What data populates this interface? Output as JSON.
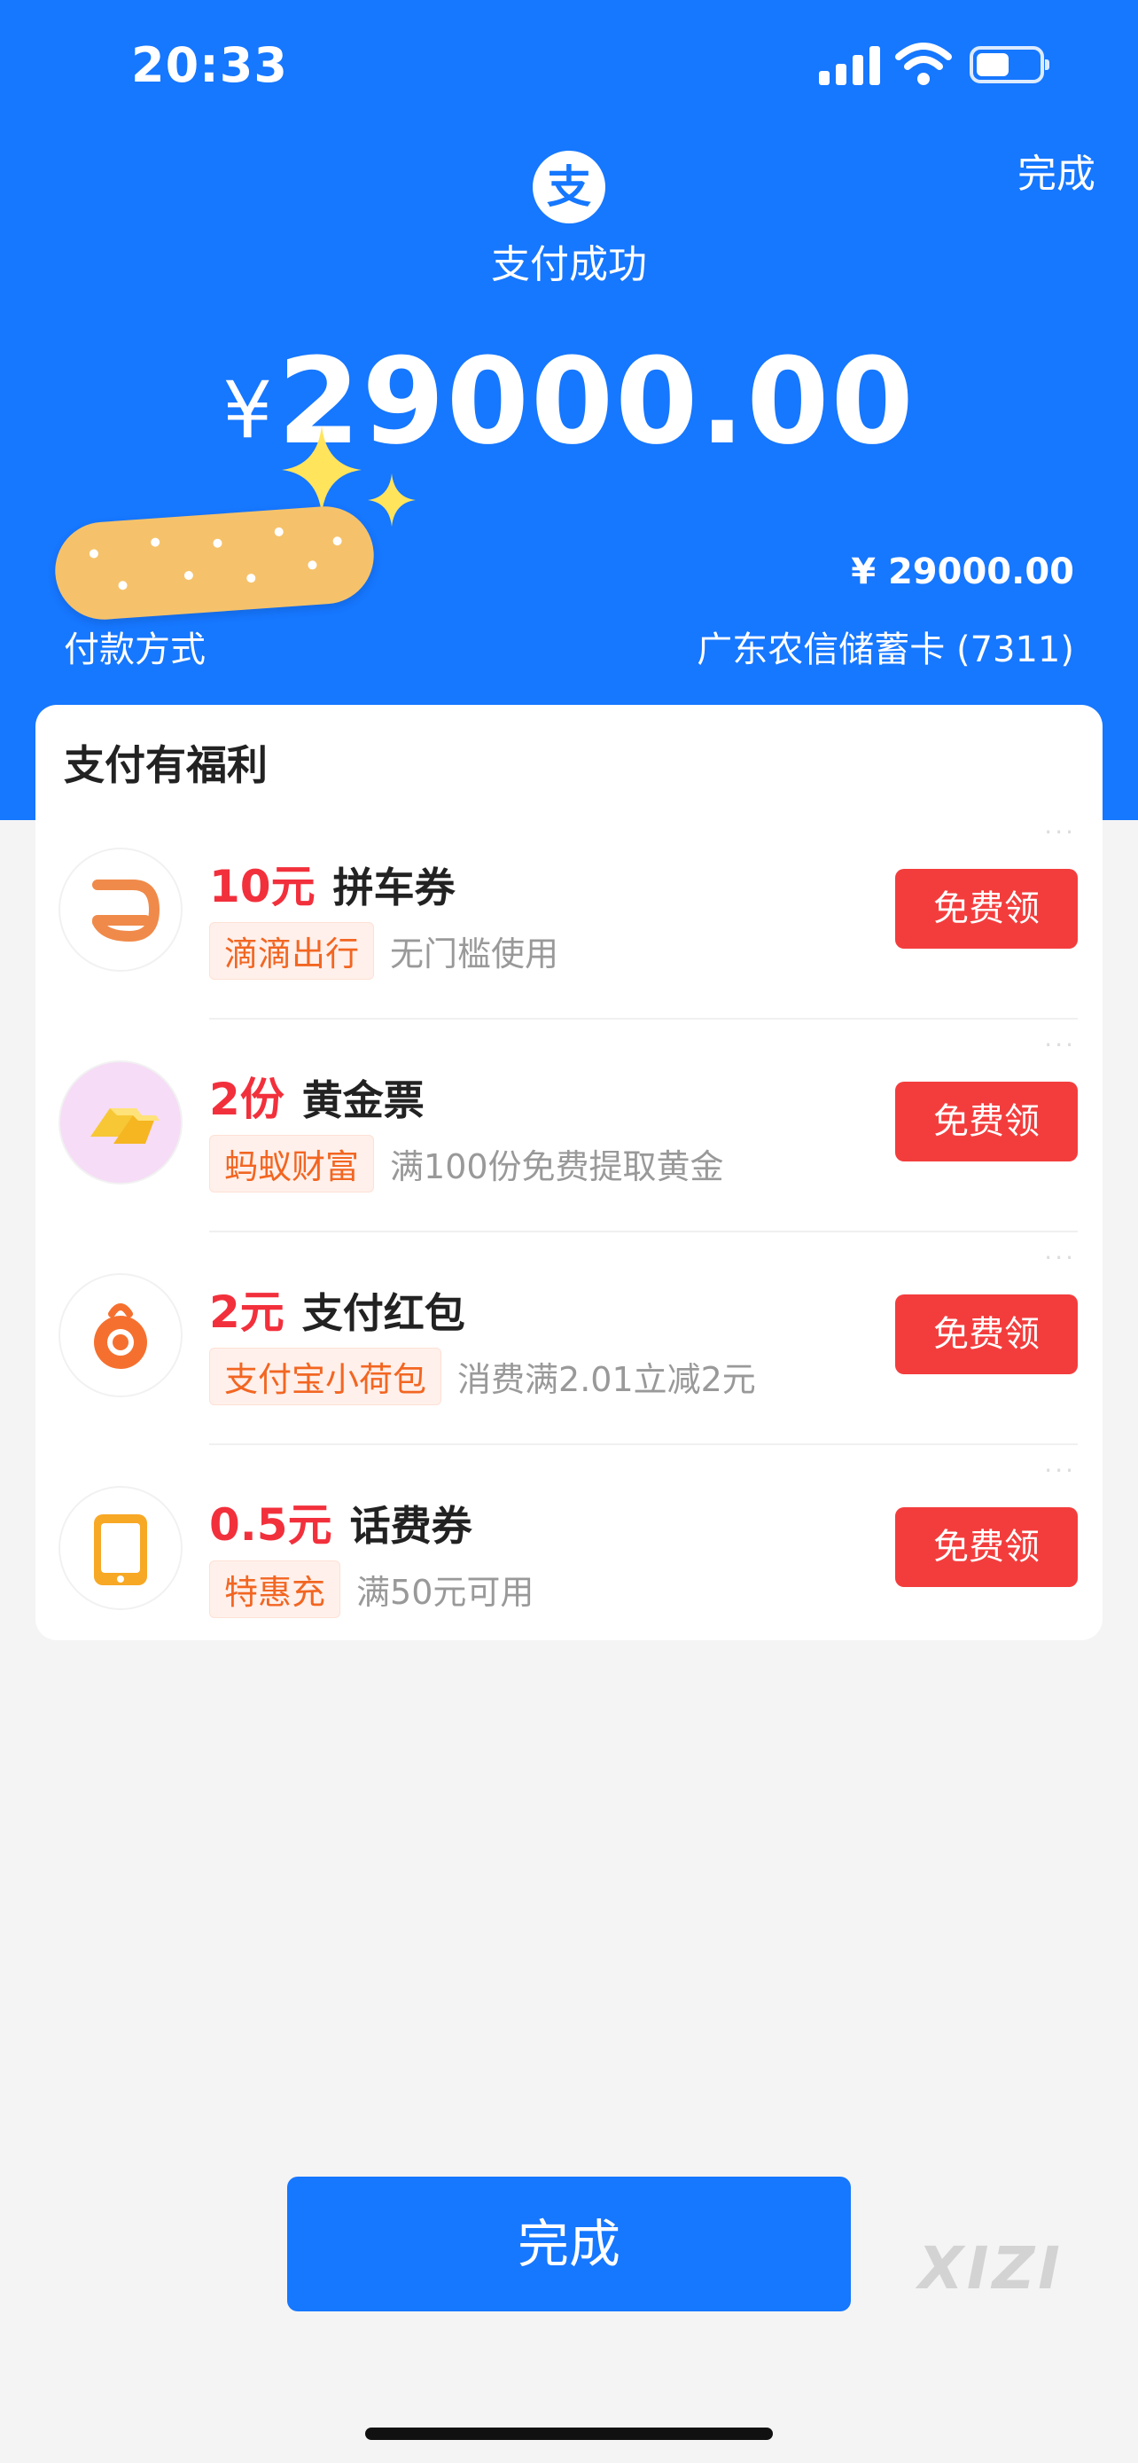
{
  "status_bar": {
    "time": "20:33"
  },
  "header": {
    "done_label": "完成",
    "logo_glyph": "支",
    "title": "支付成功",
    "currency_symbol": "¥",
    "amount": "29000.00",
    "paid_amount": "¥ 29000.00",
    "payment_method_label": "付款方式",
    "payment_method_value": "广东农信储蓄卡 (7311)"
  },
  "benefits": {
    "title": "支付有福利",
    "items": [
      {
        "amount": "10元",
        "name": "拼车券",
        "tag": "滴滴出行",
        "desc": "无门槛使用",
        "button": "免费领",
        "icon": "didi-icon"
      },
      {
        "amount": "2份",
        "name": "黄金票",
        "tag": "蚂蚁财富",
        "desc": "满100份免费提取黄金",
        "button": "免费领",
        "icon": "gold-bar-icon"
      },
      {
        "amount": "2元",
        "name": "支付红包",
        "tag": "支付宝小荷包",
        "desc": "消费满2.01立减2元",
        "button": "免费领",
        "icon": "wallet-pouch-icon"
      },
      {
        "amount": "0.5元",
        "name": "话费券",
        "tag": "特惠充",
        "desc": "满50元可用",
        "button": "免费领",
        "icon": "phone-icon"
      }
    ]
  },
  "footer": {
    "done_button": "完成",
    "watermark": "XIZI"
  },
  "colors": {
    "brand_blue": "#1677ff",
    "accent_red": "#f2303c",
    "tag_orange": "#f26622"
  }
}
